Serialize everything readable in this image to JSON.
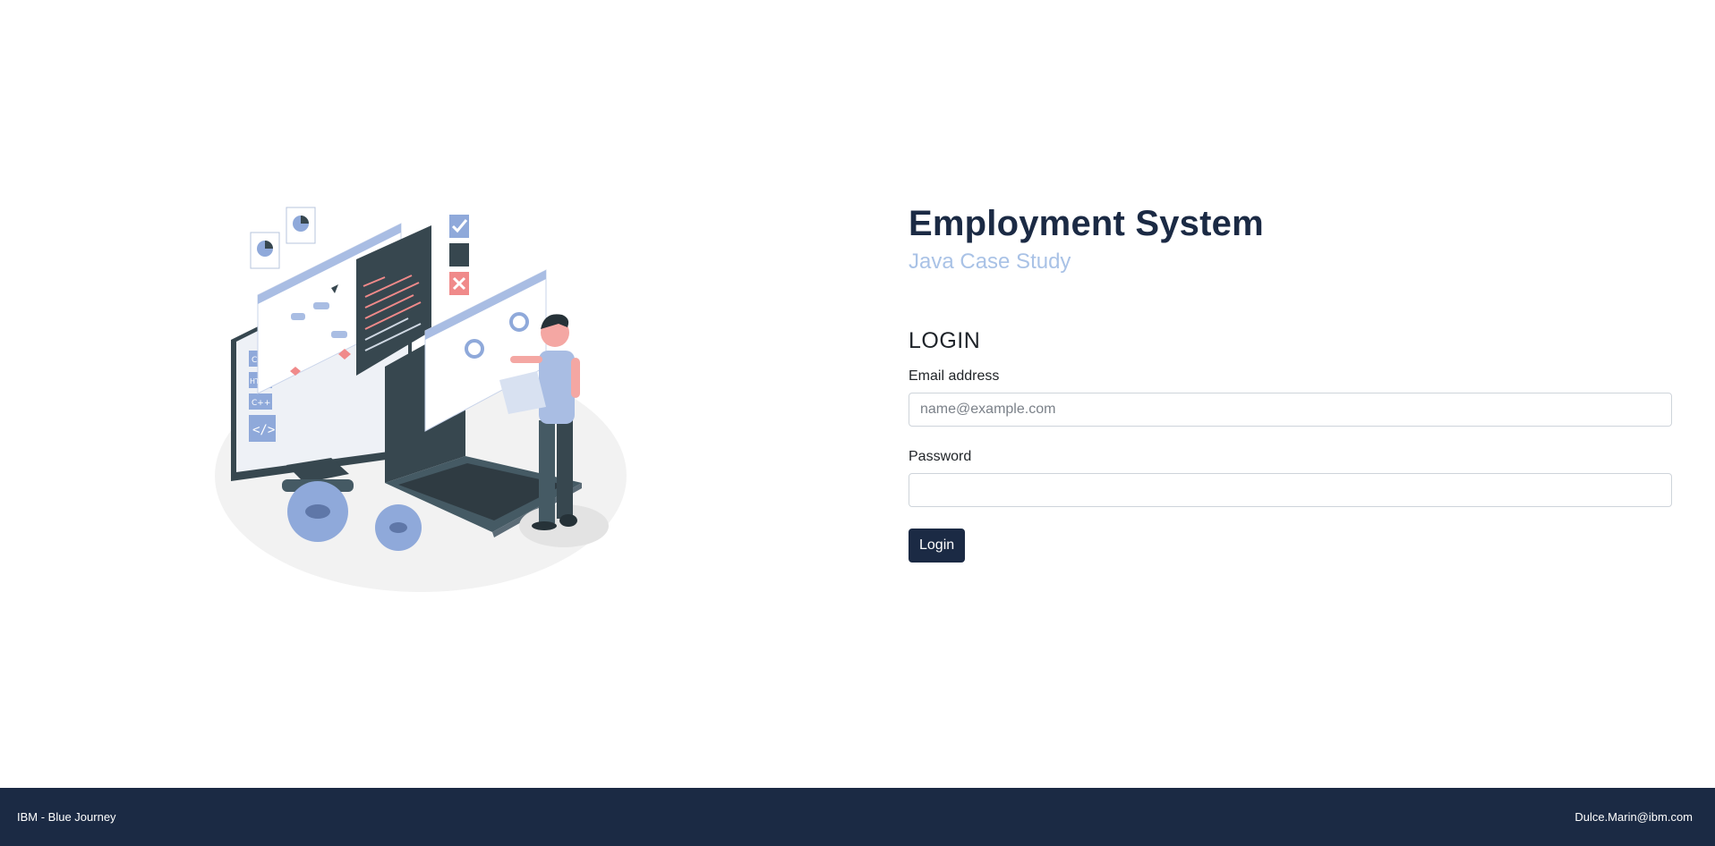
{
  "header": {
    "title": "Employment System",
    "subtitle": "Java Case Study"
  },
  "illustration": {
    "code_labels": [
      "CSS",
      "HTML",
      "C++"
    ]
  },
  "login": {
    "heading": "LOGIN",
    "email_label": "Email address",
    "email_placeholder": "name@example.com",
    "email_value": "",
    "password_label": "Password",
    "password_value": "",
    "button_label": "Login"
  },
  "footer": {
    "left_text": "IBM - Blue Journey",
    "right_text": "Dulce.Marin@ibm.com"
  },
  "colors": {
    "primary": "#1b2a44",
    "subtitle": "#a9c2e6",
    "accent_blue": "#8fa9da",
    "accent_red": "#f08a8a"
  }
}
